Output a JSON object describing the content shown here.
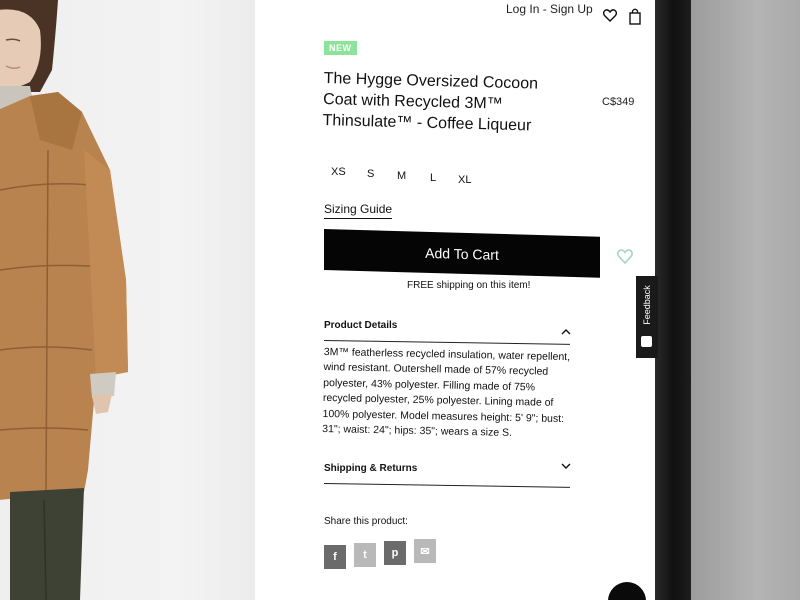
{
  "header": {
    "login_label": "Log In - Sign Up",
    "wishlist_icon": "heart-icon",
    "cart_icon": "shopping-bag-icon"
  },
  "product": {
    "badge": "NEW",
    "title": "The Hygge Oversized Cocoon Coat with Recycled 3M™ Thinsulate™ - Coffee Liqueur",
    "price": "C$349",
    "sizes": [
      "XS",
      "S",
      "M",
      "L",
      "XL"
    ],
    "sizing_guide_label": "Sizing Guide",
    "add_to_cart_label": "Add To Cart",
    "free_shipping_text": "FREE shipping on this item!"
  },
  "accordion": {
    "details_title": "Product Details",
    "details_body": "3M™ featherless recycled insulation, water repellent, wind resistant. Outershell made of 57% recycled polyester, 43% polyester. Filling made of 75% recycled polyester, 25% polyester. Lining made of 100% polyester. Model measures height: 5' 9\"; bust: 31\"; waist: 24\"; hips: 35\"; wears a size S.",
    "shipping_title": "Shipping & Returns"
  },
  "share": {
    "label": "Share this product:",
    "buttons": [
      {
        "name": "facebook",
        "glyph": "f",
        "color": "#6b6b6b"
      },
      {
        "name": "twitter",
        "glyph": "t",
        "color": "#b9b9b9"
      },
      {
        "name": "pinterest",
        "glyph": "p",
        "color": "#6b6b6b"
      },
      {
        "name": "email",
        "glyph": "✉",
        "color": "#b9b9b9"
      }
    ]
  },
  "feedback": {
    "label": "Feedback"
  },
  "colors": {
    "badge_green": "#8ee39b",
    "cart_button": "#050505",
    "wishlist_heart": "#9fd4c0"
  }
}
